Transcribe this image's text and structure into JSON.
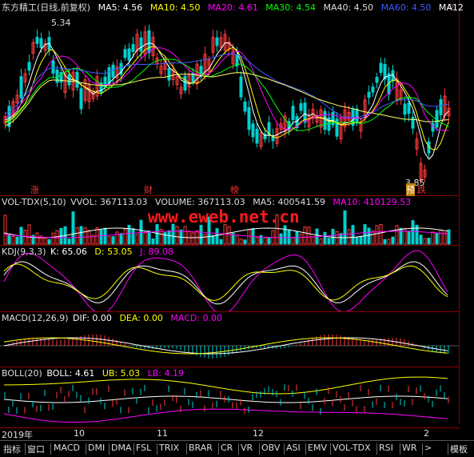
{
  "colors": {
    "up": "#ff3b3b",
    "down": "#00d0d0",
    "ma5": "#ffffff",
    "ma10": "#ffff00",
    "ma20": "#ff00ff",
    "ma30": "#00ff00",
    "ma40": "#cccccc",
    "ma60": "#3a5bff",
    "ma120": "#ffff66"
  },
  "main": {
    "title": "东方精工(日线,前复权)",
    "ma5": "MA5: 4.56",
    "ma10": "MA10: 4.50",
    "ma20": "MA20: 4.61",
    "ma30": "MA30: 4.54",
    "ma40": "MA40: 4.50",
    "ma60": "MA60: 4.50",
    "ma120": "MA12",
    "high_label": "5.34",
    "low_label": "3.85",
    "events": [
      "涨",
      "财",
      "榜",
      "预",
      "跌"
    ]
  },
  "vol": {
    "name": "VOL-TDX(5,10)",
    "vvol": "VVOL: 367113.03",
    "volume": "VOLUME: 367113.03",
    "ma5": "MA5: 400541.59",
    "ma10": "MA10: 410129.53"
  },
  "kdj": {
    "name": "KDJ(9,3,3)",
    "k": "K: 65.06",
    "d": "D: 53.05",
    "j": "J: 89.08"
  },
  "macd": {
    "name": "MACD(12,26,9)",
    "dif": "DIF: 0.00",
    "dea": "DEA: 0.00",
    "macd": "MACD: 0.00"
  },
  "boll": {
    "name": "BOLL(20)",
    "boll": "BOLL: 4.61",
    "ub": "UB: 5.03",
    "lb": "LB: 4.19"
  },
  "watermark": "www.eweb.net.cn",
  "date_axis": [
    "2019年",
    "10",
    "11",
    "12",
    "2"
  ],
  "tabs": [
    "指标",
    "窗口",
    "MACD",
    "DMI",
    "DMA",
    "FSL",
    "TRIX",
    "BRAR",
    "CR",
    "VR",
    "OBV",
    "ASI",
    "EMV",
    "VOL-TDX",
    "RSI",
    "WR",
    ">",
    "模板"
  ],
  "chart_data": {
    "type": "candlestick",
    "title": "东方精工(日线,前复权)",
    "annotations": [
      "5.34",
      "3.85"
    ],
    "moving_averages": {
      "MA5": 4.56,
      "MA10": 4.5,
      "MA20": 4.61,
      "MA30": 4.54,
      "MA40": 4.5,
      "MA60": 4.5
    }
  }
}
